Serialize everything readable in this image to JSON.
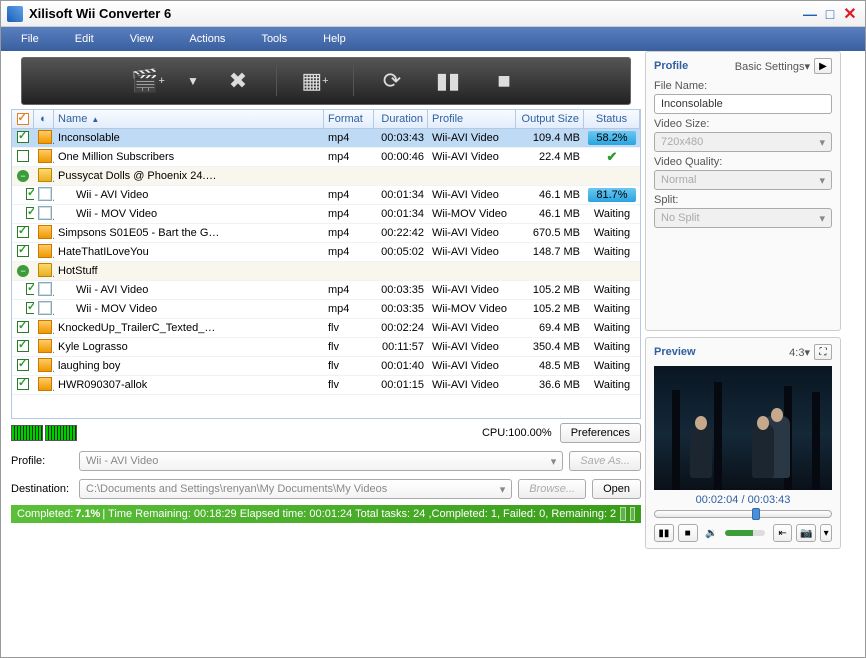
{
  "title": "Xilisoft Wii Converter 6",
  "menu": [
    "File",
    "Edit",
    "View",
    "Actions",
    "Tools",
    "Help"
  ],
  "columns": {
    "name": "Name",
    "format": "Format",
    "duration": "Duration",
    "profile": "Profile",
    "size": "Output Size",
    "status": "Status"
  },
  "rows": [
    {
      "indent": 0,
      "chk": true,
      "ico": "video",
      "name": "Inconsolable",
      "fmt": "mp4",
      "dur": "00:03:43",
      "prof": "Wii-AVI Video",
      "size": "109.4 MB",
      "stat": "58.2%",
      "progress": 58.2,
      "sel": true
    },
    {
      "indent": 0,
      "chk": false,
      "ico": "video",
      "name": "One Million Subscribers",
      "fmt": "mp4",
      "dur": "00:00:46",
      "prof": "Wii-AVI Video",
      "size": "22.4 MB",
      "stat": "ok"
    },
    {
      "group": true,
      "ico": "folder",
      "name": "Pussycat Dolls @ Phoenix 24.…"
    },
    {
      "indent": 1,
      "chk": true,
      "ico": "page",
      "name": "Wii - AVI Video",
      "fmt": "mp4",
      "dur": "00:01:34",
      "prof": "Wii-AVI Video",
      "size": "46.1 MB",
      "stat": "81.7%",
      "progress": 81.7
    },
    {
      "indent": 1,
      "chk": true,
      "ico": "page",
      "name": "Wii - MOV Video",
      "fmt": "mp4",
      "dur": "00:01:34",
      "prof": "Wii-MOV Video",
      "size": "46.1 MB",
      "stat": "Waiting"
    },
    {
      "indent": 0,
      "chk": true,
      "ico": "video",
      "name": "Simpsons S01E05 - Bart the G…",
      "fmt": "mp4",
      "dur": "00:22:42",
      "prof": "Wii-AVI Video",
      "size": "670.5 MB",
      "stat": "Waiting"
    },
    {
      "indent": 0,
      "chk": true,
      "ico": "video",
      "name": "HateThatILoveYou",
      "fmt": "mp4",
      "dur": "00:05:02",
      "prof": "Wii-AVI Video",
      "size": "148.7 MB",
      "stat": "Waiting"
    },
    {
      "group": true,
      "ico": "folder",
      "name": "HotStuff"
    },
    {
      "indent": 1,
      "chk": true,
      "ico": "page",
      "name": "Wii - AVI Video",
      "fmt": "mp4",
      "dur": "00:03:35",
      "prof": "Wii-AVI Video",
      "size": "105.2 MB",
      "stat": "Waiting"
    },
    {
      "indent": 1,
      "chk": true,
      "ico": "page",
      "name": "Wii - MOV Video",
      "fmt": "mp4",
      "dur": "00:03:35",
      "prof": "Wii-MOV Video",
      "size": "105.2 MB",
      "stat": "Waiting"
    },
    {
      "indent": 0,
      "chk": true,
      "ico": "video",
      "name": "KnockedUp_TrailerC_Texted_…",
      "fmt": "flv",
      "dur": "00:02:24",
      "prof": "Wii-AVI Video",
      "size": "69.4 MB",
      "stat": "Waiting"
    },
    {
      "indent": 0,
      "chk": true,
      "ico": "video",
      "name": "Kyle Lograsso",
      "fmt": "flv",
      "dur": "00:11:57",
      "prof": "Wii-AVI Video",
      "size": "350.4 MB",
      "stat": "Waiting"
    },
    {
      "indent": 0,
      "chk": true,
      "ico": "video",
      "name": "laughing boy",
      "fmt": "flv",
      "dur": "00:01:40",
      "prof": "Wii-AVI Video",
      "size": "48.5 MB",
      "stat": "Waiting"
    },
    {
      "indent": 0,
      "chk": true,
      "ico": "video",
      "name": "HWR090307-allok",
      "fmt": "flv",
      "dur": "00:01:15",
      "prof": "Wii-AVI Video",
      "size": "36.6 MB",
      "stat": "Waiting"
    }
  ],
  "cpu": "CPU:100.00%",
  "preferences": "Preferences",
  "profileLabel": "Profile:",
  "profileValue": "Wii - AVI Video",
  "saveAs": "Save As...",
  "destLabel": "Destination:",
  "destValue": "C:\\Documents and Settings\\renyan\\My Documents\\My Videos",
  "browse": "Browse...",
  "open": "Open",
  "status": {
    "completedLabel": "Completed:",
    "completedPct": "7.1%",
    "rest": " | Time Remaining: 00:18:29 Elapsed time: 00:01:24 Total tasks: 24 ,Completed: 1, Failed: 0, Remaining: 2"
  },
  "side": {
    "profile": "Profile",
    "basic": "Basic Settings",
    "fileName": "File Name:",
    "fileNameV": "Inconsolable",
    "videoSize": "Video Size:",
    "videoSizeV": "720x480",
    "videoQuality": "Video Quality:",
    "videoQualityV": "Normal",
    "split": "Split:",
    "splitV": "No Split",
    "preview": "Preview",
    "aspect": "4:3",
    "time": "00:02:04 / 00:03:43",
    "seekPct": 55
  }
}
